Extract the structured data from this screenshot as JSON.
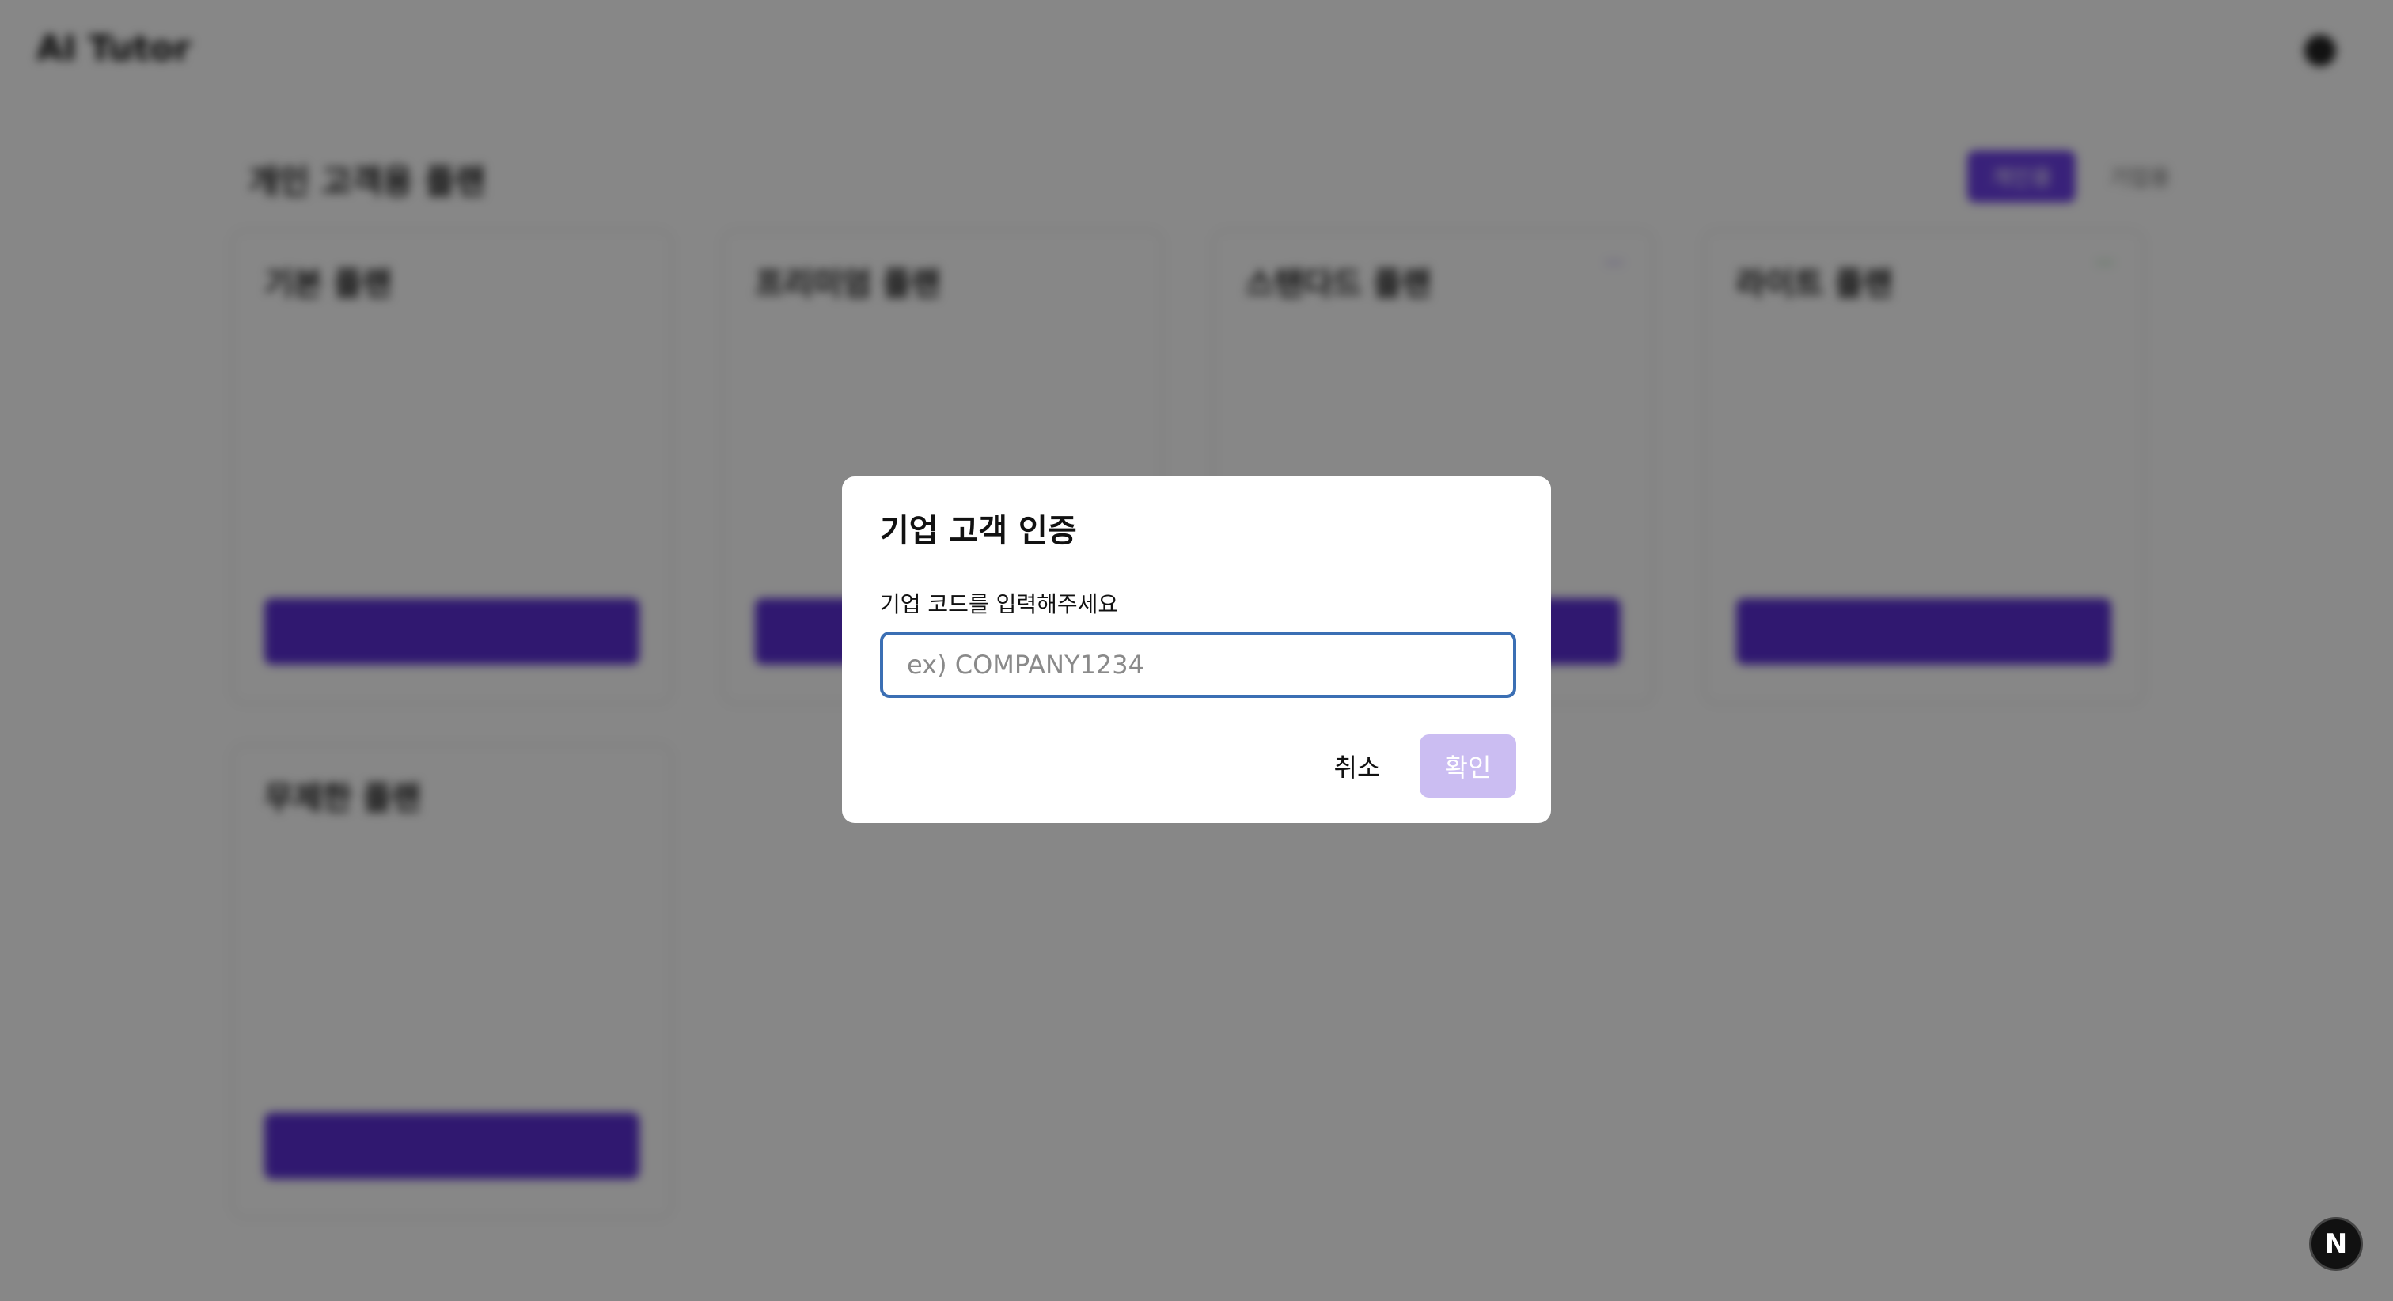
{
  "app": {
    "title": "AI Tutor"
  },
  "plans": {
    "title": "개인 고객용 플랜",
    "toggle": [
      "개인용",
      "기업용"
    ],
    "cards": [
      {
        "name": "기본 플랜",
        "price": "",
        "badge": "",
        "features": [
          "",
          "",
          ""
        ],
        "cta": ""
      },
      {
        "name": "프리미엄 플랜",
        "price": "",
        "badge": "",
        "features": [
          "",
          "",
          ""
        ],
        "cta": ""
      },
      {
        "name": "스탠다드 플랜",
        "price": "",
        "badge": "",
        "features": [
          "",
          "",
          ""
        ],
        "cta": ""
      },
      {
        "name": "라이트 플랜",
        "price": "",
        "badge": "",
        "features": [
          "",
          "",
          ""
        ],
        "cta": ""
      },
      {
        "name": "무제한 플랜",
        "price": "",
        "badge": "",
        "features": [
          "",
          "",
          ""
        ],
        "cta": ""
      }
    ]
  },
  "modal": {
    "title": "기업 고객 인증",
    "label": "기업 코드를 입력해주세요",
    "input_value": "",
    "input_placeholder": "ex) COMPANY1234",
    "cancel_label": "취소",
    "confirm_label": "확인"
  },
  "fab": {
    "label": "N"
  },
  "colors": {
    "accent": "#5b2fd4",
    "confirm_disabled": "#cbbdf2",
    "input_focus_border": "#3b6fb4",
    "overlay": "rgba(0,0,0,0.47)"
  }
}
